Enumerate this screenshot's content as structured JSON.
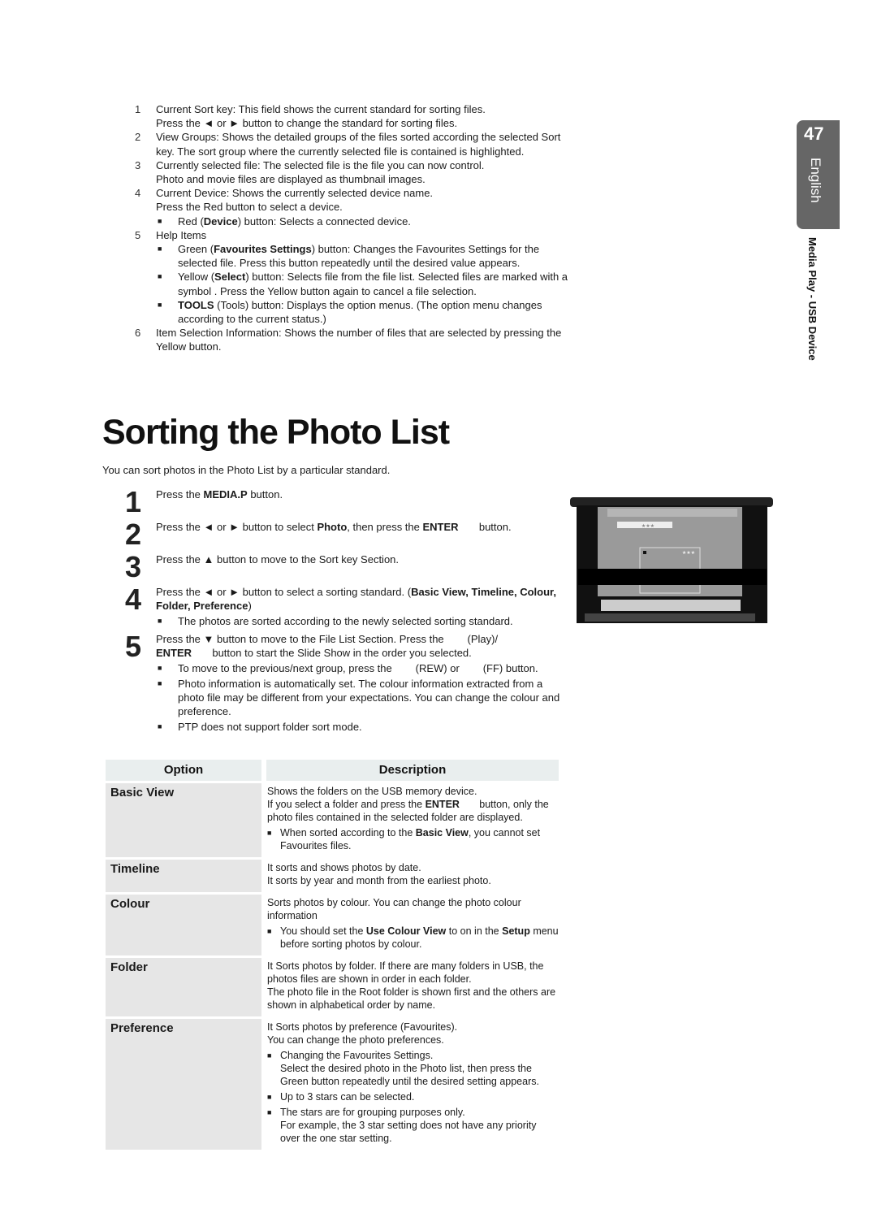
{
  "top_list": [
    {
      "n": "1",
      "lines": [
        [
          "Current Sort key: This field shows the current standard for sorting files."
        ],
        [
          "Press the ◄ or ► button to change the standard for sorting files."
        ]
      ],
      "subs": []
    },
    {
      "n": "2",
      "lines": [
        [
          "View Groups: Shows the detailed groups of the files sorted according the selected Sort key. The sort group where the currently selected file is contained is highlighted."
        ]
      ],
      "subs": []
    },
    {
      "n": "3",
      "lines": [
        [
          "Currently selected file: The selected file is the file you can now control."
        ],
        [
          "Photo and movie files are displayed as thumbnail images."
        ]
      ],
      "subs": []
    },
    {
      "n": "4",
      "lines": [
        [
          "Current Device: Shows the currently selected device name."
        ],
        [
          "Press the Red button to select a device."
        ]
      ],
      "subs": [
        {
          "pre": "Red (",
          "bold": "Device",
          "post": ") button: Selects a connected device."
        }
      ]
    },
    {
      "n": "5",
      "lines": [
        [
          "Help Items"
        ]
      ],
      "subs": [
        {
          "pre": "Green (",
          "bold": "Favourites Settings",
          "post": ") button: Changes the Favourites Settings for the selected file. Press this button repeatedly until the desired value appears."
        },
        {
          "pre": "Yellow (",
          "bold": "Select",
          "post": ") button: Selects file from the file list. Selected files are marked with a symbol      . Press the Yellow button again to cancel a file selection."
        },
        {
          "pre": "",
          "bold": "TOOLS",
          "post": " (Tools) button: Displays the option menus. (The option menu changes according to the current status.)"
        }
      ]
    },
    {
      "n": "6",
      "lines": [
        [
          "Item Selection Information: Shows the number of files that are selected by pressing the Yellow button."
        ]
      ],
      "subs": []
    }
  ],
  "side": {
    "page_number": "47",
    "language": "English",
    "section": "Media Play - USB Device"
  },
  "title": "Sorting the Photo List",
  "intro": "You can sort photos in the Photo List by a particular standard.",
  "steps": [
    {
      "n": "1",
      "html": "Press the <b>MEDIA.P</b> button.",
      "subs": []
    },
    {
      "n": "2",
      "html": "Press the ◄ or ► button to select <b>Photo</b>, then press the <b>ENTER</b>&nbsp;&nbsp;&nbsp;&nbsp;&nbsp;&nbsp; button.",
      "subs": []
    },
    {
      "n": "3",
      "html": "Press the ▲ button to move to the Sort key Section.",
      "subs": []
    },
    {
      "n": "4",
      "html": "Press the ◄ or ► button to select a sorting standard. (<b>Basic View, Timeline, Colour, Folder, Preference</b>)",
      "subs": [
        "The photos are sorted according to the newly selected sorting standard."
      ]
    },
    {
      "n": "5",
      "html": "Press the ▼ button to move to the File List Section. Press the &nbsp;&nbsp;&nbsp;&nbsp;&nbsp;&nbsp;&nbsp;(Play)/<br><b>ENTER</b>&nbsp;&nbsp;&nbsp;&nbsp;&nbsp;&nbsp; button to start the Slide Show in the order you selected.",
      "subs": [
        "To move to the previous/next group, press the &nbsp;&nbsp;&nbsp;&nbsp;&nbsp;&nbsp;&nbsp;(REW) or &nbsp;&nbsp;&nbsp;&nbsp;&nbsp;&nbsp;&nbsp;(FF) button.",
        "Photo information is automatically set. The colour information extracted from a photo file may be different from your expectations. You can change the colour and preference.",
        "PTP does not support folder sort mode."
      ]
    }
  ],
  "table": {
    "headers": [
      "Option",
      "Description"
    ],
    "rows": [
      {
        "option": "Basic View",
        "desc": [
          "Shows the folders on the USB memory device.",
          "If you select a folder and press the <b>ENTER</b>&nbsp;&nbsp;&nbsp;&nbsp;&nbsp;&nbsp; button, only the photo files contained in the selected folder are displayed."
        ],
        "subs": [
          "When sorted according to the <b>Basic View</b>, you cannot set Favourites files."
        ]
      },
      {
        "option": "Timeline",
        "desc": [
          "It sorts and shows photos by date.",
          "It sorts by year and month from the earliest photo."
        ],
        "subs": []
      },
      {
        "option": "Colour",
        "desc": [
          "Sorts photos by colour. You can change the photo colour information"
        ],
        "subs": [
          "You should set the <b>Use Colour View</b> to on in the <b>Setup</b> menu before sorting photos by colour."
        ]
      },
      {
        "option": "Folder",
        "desc": [
          "It Sorts photos by folder. If there are many folders in USB, the photos files are shown in order in each folder.",
          "The photo file in the Root folder is shown first and the others are shown in alphabetical order by name."
        ],
        "subs": []
      },
      {
        "option": "Preference",
        "desc": [
          "It Sorts photos by preference (Favourites).",
          "You can change the photo preferences."
        ],
        "subs": [
          "Changing the Favourites Settings.<br>Select the desired photo in the Photo list, then press the Green button repeatedly until the desired setting appears.",
          "Up to 3 stars can be selected.",
          "The stars are for grouping purposes only.<br>For example, the 3 star setting does not have any priority over the one star setting."
        ]
      }
    ]
  },
  "tv_screen": {
    "stars_label": "★★★",
    "selected_stars": "★★★"
  }
}
